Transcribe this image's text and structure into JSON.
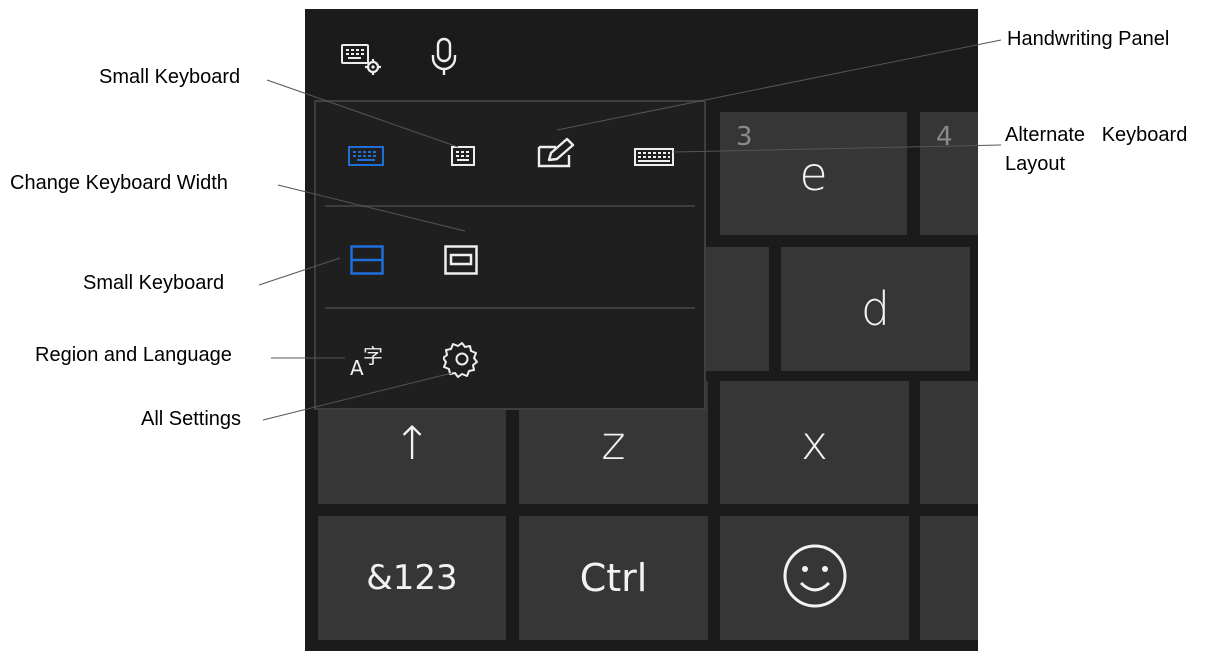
{
  "toolbar": {
    "icons": [
      "keyboard-settings-icon",
      "microphone-icon"
    ]
  },
  "keys": {
    "e": {
      "number": "3",
      "letter": "e"
    },
    "r_partial": {
      "number": "4"
    },
    "d": {
      "letter": "d"
    },
    "shift": {
      "glyph": "↑"
    },
    "z": {
      "letter": "z"
    },
    "x": {
      "letter": "x"
    },
    "symbols": {
      "label": "&123"
    },
    "ctrl": {
      "label": "Ctrl"
    },
    "emoji": {
      "icon": "smiley-icon"
    }
  },
  "flyout": {
    "row1_icons": [
      "default-keyboard-icon",
      "small-keyboard-icon",
      "handwriting-pen-icon",
      "full-keyboard-icon"
    ],
    "row2_icons": [
      "docked-keyboard-icon",
      "undocked-keyboard-icon"
    ],
    "row3": {
      "language_glyph_latin": "A",
      "language_glyph_cjk": "字",
      "settings_icon": "gear-icon"
    }
  },
  "callouts": {
    "small_keyboard_top": "Small Keyboard",
    "change_width": "Change Keyboard Width",
    "small_keyboard_mid": "Small Keyboard",
    "region_language": "Region and Language",
    "all_settings": "All Settings",
    "handwriting": "Handwriting Panel",
    "alternate_line1": "Alternate   Keyboard",
    "alternate_line2": "Layout"
  },
  "colors": {
    "accent": "#1e6fd9",
    "key_bg": "#363636",
    "panel_bg": "#1f1f1f",
    "background": "#1b1b1b"
  }
}
